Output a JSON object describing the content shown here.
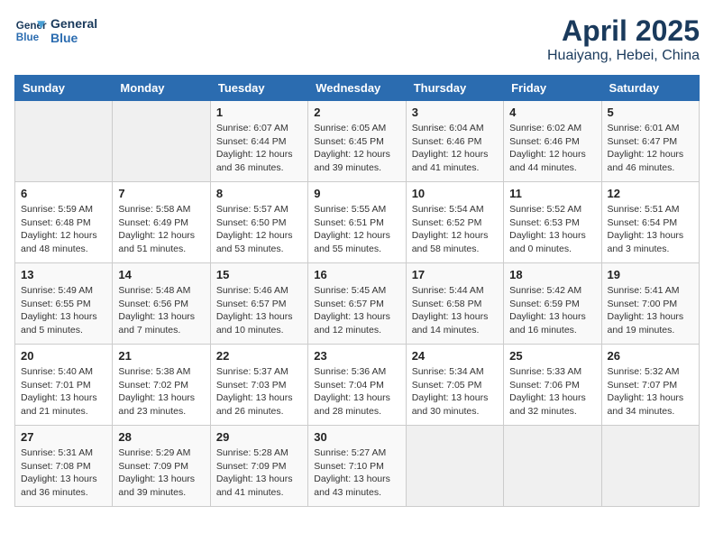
{
  "header": {
    "logo_line1": "General",
    "logo_line2": "Blue",
    "title": "April 2025",
    "subtitle": "Huaiyang, Hebei, China"
  },
  "weekdays": [
    "Sunday",
    "Monday",
    "Tuesday",
    "Wednesday",
    "Thursday",
    "Friday",
    "Saturday"
  ],
  "weeks": [
    [
      {
        "day": "",
        "sunrise": "",
        "sunset": "",
        "daylight": ""
      },
      {
        "day": "",
        "sunrise": "",
        "sunset": "",
        "daylight": ""
      },
      {
        "day": "1",
        "sunrise": "Sunrise: 6:07 AM",
        "sunset": "Sunset: 6:44 PM",
        "daylight": "Daylight: 12 hours and 36 minutes."
      },
      {
        "day": "2",
        "sunrise": "Sunrise: 6:05 AM",
        "sunset": "Sunset: 6:45 PM",
        "daylight": "Daylight: 12 hours and 39 minutes."
      },
      {
        "day": "3",
        "sunrise": "Sunrise: 6:04 AM",
        "sunset": "Sunset: 6:46 PM",
        "daylight": "Daylight: 12 hours and 41 minutes."
      },
      {
        "day": "4",
        "sunrise": "Sunrise: 6:02 AM",
        "sunset": "Sunset: 6:46 PM",
        "daylight": "Daylight: 12 hours and 44 minutes."
      },
      {
        "day": "5",
        "sunrise": "Sunrise: 6:01 AM",
        "sunset": "Sunset: 6:47 PM",
        "daylight": "Daylight: 12 hours and 46 minutes."
      }
    ],
    [
      {
        "day": "6",
        "sunrise": "Sunrise: 5:59 AM",
        "sunset": "Sunset: 6:48 PM",
        "daylight": "Daylight: 12 hours and 48 minutes."
      },
      {
        "day": "7",
        "sunrise": "Sunrise: 5:58 AM",
        "sunset": "Sunset: 6:49 PM",
        "daylight": "Daylight: 12 hours and 51 minutes."
      },
      {
        "day": "8",
        "sunrise": "Sunrise: 5:57 AM",
        "sunset": "Sunset: 6:50 PM",
        "daylight": "Daylight: 12 hours and 53 minutes."
      },
      {
        "day": "9",
        "sunrise": "Sunrise: 5:55 AM",
        "sunset": "Sunset: 6:51 PM",
        "daylight": "Daylight: 12 hours and 55 minutes."
      },
      {
        "day": "10",
        "sunrise": "Sunrise: 5:54 AM",
        "sunset": "Sunset: 6:52 PM",
        "daylight": "Daylight: 12 hours and 58 minutes."
      },
      {
        "day": "11",
        "sunrise": "Sunrise: 5:52 AM",
        "sunset": "Sunset: 6:53 PM",
        "daylight": "Daylight: 13 hours and 0 minutes."
      },
      {
        "day": "12",
        "sunrise": "Sunrise: 5:51 AM",
        "sunset": "Sunset: 6:54 PM",
        "daylight": "Daylight: 13 hours and 3 minutes."
      }
    ],
    [
      {
        "day": "13",
        "sunrise": "Sunrise: 5:49 AM",
        "sunset": "Sunset: 6:55 PM",
        "daylight": "Daylight: 13 hours and 5 minutes."
      },
      {
        "day": "14",
        "sunrise": "Sunrise: 5:48 AM",
        "sunset": "Sunset: 6:56 PM",
        "daylight": "Daylight: 13 hours and 7 minutes."
      },
      {
        "day": "15",
        "sunrise": "Sunrise: 5:46 AM",
        "sunset": "Sunset: 6:57 PM",
        "daylight": "Daylight: 13 hours and 10 minutes."
      },
      {
        "day": "16",
        "sunrise": "Sunrise: 5:45 AM",
        "sunset": "Sunset: 6:57 PM",
        "daylight": "Daylight: 13 hours and 12 minutes."
      },
      {
        "day": "17",
        "sunrise": "Sunrise: 5:44 AM",
        "sunset": "Sunset: 6:58 PM",
        "daylight": "Daylight: 13 hours and 14 minutes."
      },
      {
        "day": "18",
        "sunrise": "Sunrise: 5:42 AM",
        "sunset": "Sunset: 6:59 PM",
        "daylight": "Daylight: 13 hours and 16 minutes."
      },
      {
        "day": "19",
        "sunrise": "Sunrise: 5:41 AM",
        "sunset": "Sunset: 7:00 PM",
        "daylight": "Daylight: 13 hours and 19 minutes."
      }
    ],
    [
      {
        "day": "20",
        "sunrise": "Sunrise: 5:40 AM",
        "sunset": "Sunset: 7:01 PM",
        "daylight": "Daylight: 13 hours and 21 minutes."
      },
      {
        "day": "21",
        "sunrise": "Sunrise: 5:38 AM",
        "sunset": "Sunset: 7:02 PM",
        "daylight": "Daylight: 13 hours and 23 minutes."
      },
      {
        "day": "22",
        "sunrise": "Sunrise: 5:37 AM",
        "sunset": "Sunset: 7:03 PM",
        "daylight": "Daylight: 13 hours and 26 minutes."
      },
      {
        "day": "23",
        "sunrise": "Sunrise: 5:36 AM",
        "sunset": "Sunset: 7:04 PM",
        "daylight": "Daylight: 13 hours and 28 minutes."
      },
      {
        "day": "24",
        "sunrise": "Sunrise: 5:34 AM",
        "sunset": "Sunset: 7:05 PM",
        "daylight": "Daylight: 13 hours and 30 minutes."
      },
      {
        "day": "25",
        "sunrise": "Sunrise: 5:33 AM",
        "sunset": "Sunset: 7:06 PM",
        "daylight": "Daylight: 13 hours and 32 minutes."
      },
      {
        "day": "26",
        "sunrise": "Sunrise: 5:32 AM",
        "sunset": "Sunset: 7:07 PM",
        "daylight": "Daylight: 13 hours and 34 minutes."
      }
    ],
    [
      {
        "day": "27",
        "sunrise": "Sunrise: 5:31 AM",
        "sunset": "Sunset: 7:08 PM",
        "daylight": "Daylight: 13 hours and 36 minutes."
      },
      {
        "day": "28",
        "sunrise": "Sunrise: 5:29 AM",
        "sunset": "Sunset: 7:09 PM",
        "daylight": "Daylight: 13 hours and 39 minutes."
      },
      {
        "day": "29",
        "sunrise": "Sunrise: 5:28 AM",
        "sunset": "Sunset: 7:09 PM",
        "daylight": "Daylight: 13 hours and 41 minutes."
      },
      {
        "day": "30",
        "sunrise": "Sunrise: 5:27 AM",
        "sunset": "Sunset: 7:10 PM",
        "daylight": "Daylight: 13 hours and 43 minutes."
      },
      {
        "day": "",
        "sunrise": "",
        "sunset": "",
        "daylight": ""
      },
      {
        "day": "",
        "sunrise": "",
        "sunset": "",
        "daylight": ""
      },
      {
        "day": "",
        "sunrise": "",
        "sunset": "",
        "daylight": ""
      }
    ]
  ]
}
